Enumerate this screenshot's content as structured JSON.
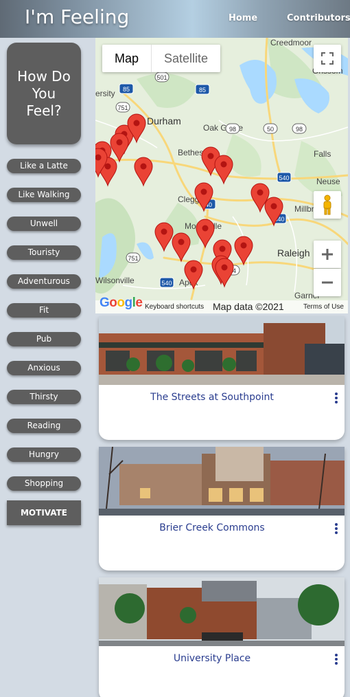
{
  "header": {
    "brand": "I'm Feeling",
    "nav": {
      "home": "Home",
      "contributors": "Contributors"
    }
  },
  "sidebar": {
    "prompt": "How Do You Feel?",
    "moods": [
      "Like a Latte",
      "Like Walking",
      "Unwell",
      "Touristy",
      "Adventurous",
      "Fit",
      "Pub",
      "Anxious",
      "Thirsty",
      "Reading",
      "Hungry",
      "Shopping"
    ],
    "motivate": "MOTIVATE"
  },
  "map": {
    "type_options": {
      "map": "Map",
      "satellite": "Satellite"
    },
    "selected_type": "Map",
    "attribution": {
      "keyboard": "Keyboard shortcuts",
      "data": "Map data ©2021",
      "terms": "Terms of Use"
    },
    "logo": "Google",
    "places": {
      "durham": "Durham",
      "oak_grove": "Oak Grove",
      "bethesda": "Bethesda",
      "clegg": "Clegg",
      "morrisville": "Morrisville",
      "raleigh": "Raleigh",
      "apex": "Apex",
      "creedmoor": "Creedmoor",
      "grissom": "Grissom",
      "falls": "Falls",
      "neuse": "Neuse",
      "millbr": "Millbr",
      "wilsonville": "Wilsonville",
      "garner": "Garner",
      "ersity": "ersity"
    },
    "route_shields": [
      "501",
      "751",
      "85",
      "85",
      "98",
      "50",
      "98",
      "540",
      "40",
      "440",
      "751",
      "540",
      "64"
    ],
    "marker_count": 20,
    "marker_color": "#ea4335"
  },
  "cards": [
    {
      "title": "The Streets at Southpoint"
    },
    {
      "title": "Brier Creek Commons"
    },
    {
      "title": "University Place"
    }
  ],
  "colors": {
    "button": "#5e5e5e",
    "card_title": "#2a3d8f",
    "background": "#d3dbe4"
  }
}
